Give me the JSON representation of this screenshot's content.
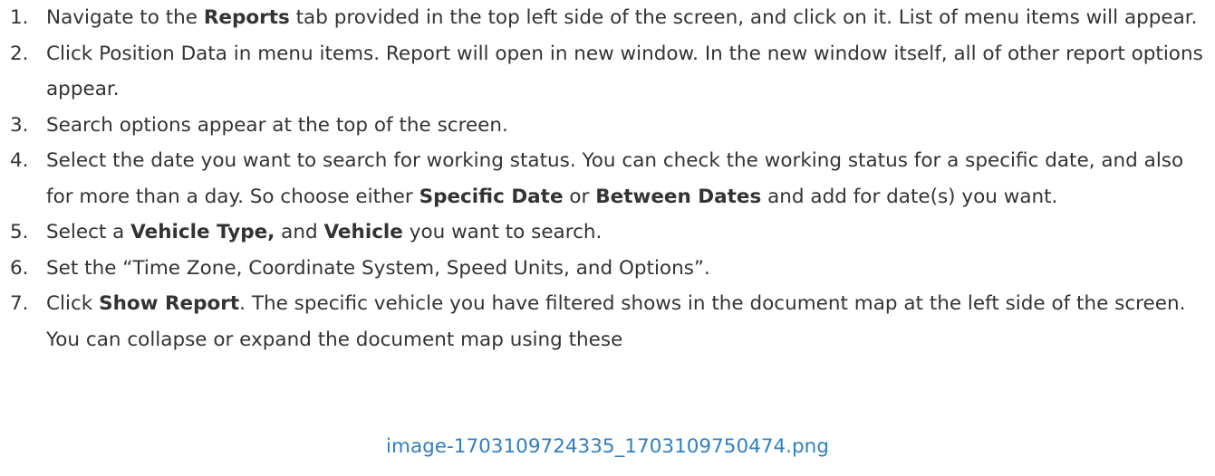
{
  "steps": [
    {
      "number": "1.",
      "parts": [
        {
          "text": "Navigate to the ",
          "bold": false
        },
        {
          "text": "Reports",
          "bold": true
        },
        {
          "text": " tab provided in the top left side of the screen, and click on it. List of menu items will appear.",
          "bold": false
        }
      ]
    },
    {
      "number": "2.",
      "parts": [
        {
          "text": "Click Position Data in menu items. Report will open in new window. In the new window itself, all of other report options appear.",
          "bold": false
        }
      ]
    },
    {
      "number": "3.",
      "parts": [
        {
          "text": "Search options appear at the top of the screen.",
          "bold": false
        }
      ]
    },
    {
      "number": "4.",
      "parts": [
        {
          "text": "Select the date you want to search for working status. You can check the working status for a specific date, and also for more than a day. So choose either ",
          "bold": false
        },
        {
          "text": "Specific Date",
          "bold": true
        },
        {
          "text": " or ",
          "bold": false
        },
        {
          "text": "Between Dates",
          "bold": true
        },
        {
          "text": " and add for date(s) you want.",
          "bold": false
        }
      ]
    },
    {
      "number": "5.",
      "parts": [
        {
          "text": "Select a ",
          "bold": false
        },
        {
          "text": "Vehicle Type,",
          "bold": true
        },
        {
          "text": " and ",
          "bold": false
        },
        {
          "text": "Vehicle",
          "bold": true
        },
        {
          "text": " you want to search.",
          "bold": false
        }
      ]
    },
    {
      "number": "6.",
      "parts": [
        {
          "text": "Set the “Time Zone, Coordinate System, Speed Units, and Options”.",
          "bold": false
        }
      ]
    },
    {
      "number": "7.",
      "parts": [
        {
          "text": "Click ",
          "bold": false
        },
        {
          "text": "Show Report",
          "bold": true
        },
        {
          "text": ". The specific vehicle you have filtered shows in the document map at the left side of the screen. You can collapse or expand the document map using these",
          "bold": false
        }
      ]
    }
  ],
  "image_link": "image-1703109724335_1703109750474.png",
  "colors": {
    "text": "#333333",
    "link": "#2f7fc1"
  }
}
